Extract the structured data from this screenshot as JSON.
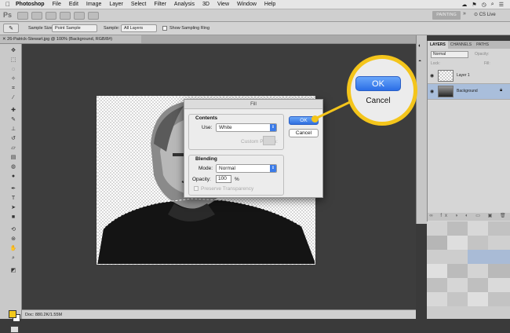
{
  "menubar": {
    "app": "Photoshop",
    "items": [
      "File",
      "Edit",
      "Image",
      "Layer",
      "Select",
      "Filter",
      "Analysis",
      "3D",
      "View",
      "Window",
      "Help"
    ]
  },
  "appbar": {
    "logo": "Ps",
    "workspace": "PAINTING",
    "more": "»",
    "cs_live": "CS Live"
  },
  "options": {
    "sample_size_label": "Sample Size:",
    "sample_size_value": "Point Sample",
    "sample_label": "Sample:",
    "sample_value": "All Layers",
    "sampling_ring_label": "Show Sampling Ring",
    "sampling_ring_checked": true
  },
  "document": {
    "tab_title": "26-Patrick-Stewart.jpg @ 100% (Background, RGB/8#)",
    "status": "Doc: 880.2K/1.55M"
  },
  "colors": {
    "foreground": "#f2c81b",
    "background": "#ffffff",
    "callout": "#f4c51b",
    "accent_blue": "#2f6fe0"
  },
  "layers_panel": {
    "tabs": [
      "LAYERS",
      "CHANNELS",
      "PATHS"
    ],
    "active_tab": "LAYERS",
    "blend_mode": "Normal",
    "opacity_label": "Opacity:",
    "lock_label": "Lock:",
    "fill_label": "Fill:",
    "layers": [
      {
        "name": "Layer 1",
        "selected": false
      },
      {
        "name": "Background",
        "selected": true,
        "locked": true
      }
    ]
  },
  "fill_dialog": {
    "title": "Fill",
    "contents_legend": "Contents",
    "use_label": "Use:",
    "use_value": "White",
    "custom_pattern_label": "Custom Pattern:",
    "blending_legend": "Blending",
    "mode_label": "Mode:",
    "mode_value": "Normal",
    "opacity_label": "Opacity:",
    "opacity_value": "100",
    "opacity_unit": "%",
    "preserve_label": "Preserve Transparency",
    "ok_label": "OK",
    "cancel_label": "Cancel"
  },
  "callout": {
    "ok_label": "OK",
    "cancel_label": "Cancel"
  }
}
